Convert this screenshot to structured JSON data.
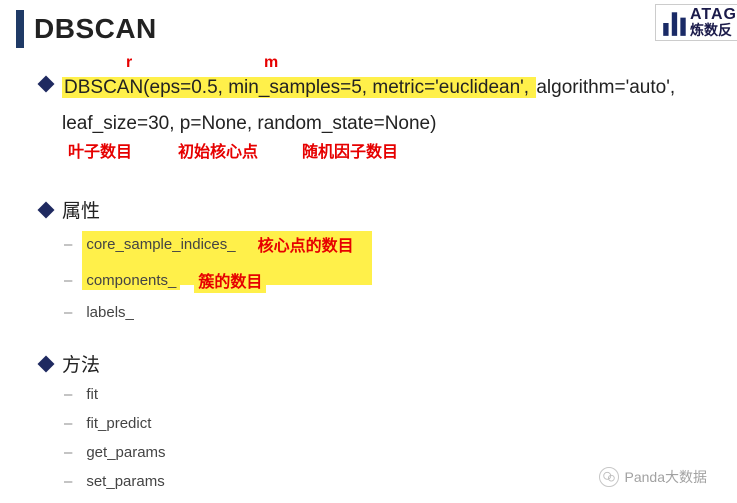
{
  "title": "DBSCAN",
  "brand": {
    "line1": "ATAG",
    "line2": "炼数反"
  },
  "signature": {
    "part1": "DBSCAN(eps=0.5, min_samples=5, metric='euclidean', ",
    "part2": "algorithm='auto',",
    "part3": "leaf_size=30, p=None, random_state=None)"
  },
  "annotations": {
    "r": "r",
    "m": "m",
    "leaf_size": "叶子数目",
    "p": "初始核心点",
    "random_state": "随机因子数目"
  },
  "sections": {
    "attributes": {
      "heading": "属性",
      "items": [
        {
          "name": "core_sample_indices_",
          "note": "核心点的数目",
          "highlight": true
        },
        {
          "name": "components_",
          "note": "簇的数目",
          "highlight": true
        },
        {
          "name": "labels_",
          "note": "",
          "highlight": false
        }
      ]
    },
    "methods": {
      "heading": "方法",
      "items": [
        {
          "name": "fit"
        },
        {
          "name": "fit_predict"
        },
        {
          "name": "get_params"
        },
        {
          "name": "set_params"
        }
      ]
    }
  },
  "watermark": "Panda大数据"
}
